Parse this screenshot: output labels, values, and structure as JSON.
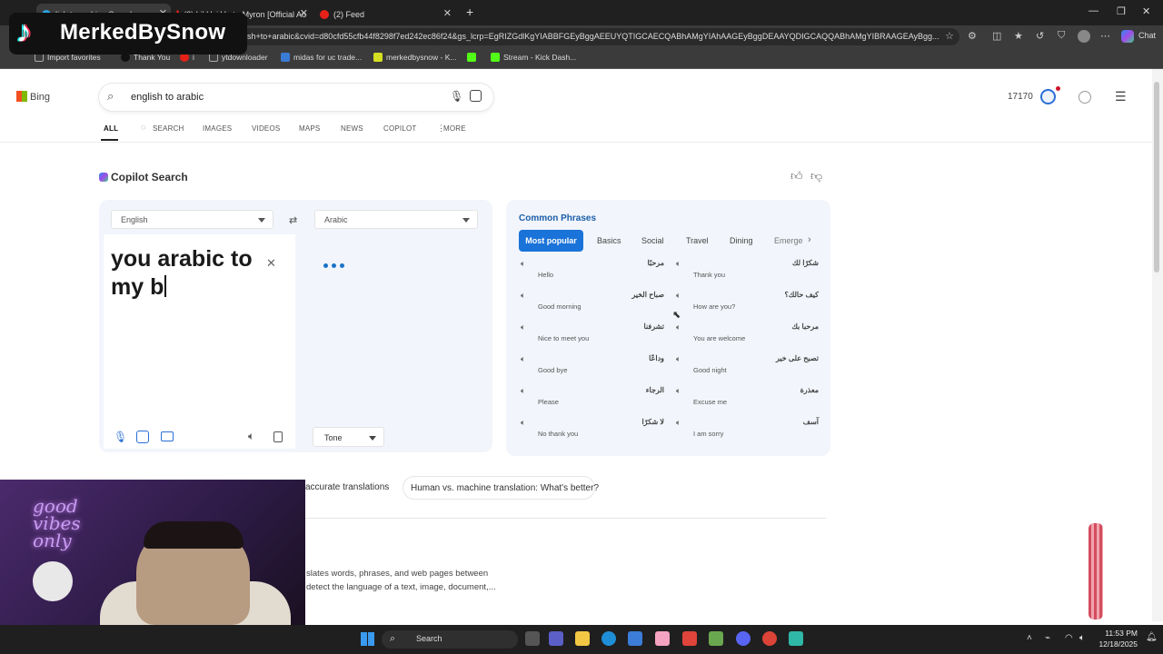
{
  "browser": {
    "tabs": [
      {
        "title": "lish to arabic - Search",
        "active": true
      },
      {
        "title": "(2) Lil Uzi Vert - Myron [Official Au",
        "active": false
      },
      {
        "title": "(2) Feed",
        "active": false
      }
    ],
    "url": "ish+to+arabic&cvid=d80cfd55cfb44f8298f7ed242ec86f24&gs_lcrp=EgRIZGdlKgYIABBFGEyBggAEEUYQTIGCAECQABhAMgYIAhAAGEyBggDEAAYQDIGCAQQABhAMgYIBRAAGEAyBgg...",
    "favorites": [
      "Import favorites",
      "Thank You",
      "i",
      "ytdownloader",
      "midas for uc trade...",
      "merkedbysnow - K...",
      "Stream - Kick Dash..."
    ],
    "chat_label": "Chat"
  },
  "bing": {
    "logo_text": "Bing",
    "query": "english to arabic",
    "rewards_count": "17170",
    "nav_tabs": [
      "ALL",
      "SEARCH",
      "IMAGES",
      "VIDEOS",
      "MAPS",
      "NEWS",
      "COPILOT",
      "MORE"
    ],
    "copilot_header": "Copilot Search"
  },
  "translator": {
    "source_lang": "English",
    "target_lang": "Arabic",
    "source_text": "you arabic to my b",
    "tone_label": "Tone"
  },
  "phrases": {
    "title": "Common Phrases",
    "tabs": [
      "Most popular",
      "Basics",
      "Social",
      "Travel",
      "Dining",
      "Emerge"
    ],
    "left": [
      {
        "ar": "مرحبًا",
        "en": "Hello"
      },
      {
        "ar": "صباح الخير",
        "en": "Good morning"
      },
      {
        "ar": "تشرفنا",
        "en": "Nice to meet you"
      },
      {
        "ar": "وداعًا",
        "en": "Good bye"
      },
      {
        "ar": "الرجاء",
        "en": "Please"
      },
      {
        "ar": "لا شكرًا",
        "en": "No thank you"
      }
    ],
    "right": [
      {
        "ar": "شكرًا لك",
        "en": "Thank you"
      },
      {
        "ar": "كيف حالك؟",
        "en": "How are you?"
      },
      {
        "ar": "مرحبا بك",
        "en": "You are welcome"
      },
      {
        "ar": "تصبح على خير",
        "en": "Good night"
      },
      {
        "ar": "معذرة",
        "en": "Excuse me"
      },
      {
        "ar": "آسف",
        "en": "I am sorry"
      }
    ]
  },
  "related": {
    "chip1": "accurate translations",
    "chip2": "Human vs. machine translation: What's better?",
    "snippet1": "slates words, phrases, and web pages between",
    "snippet2": "detect the language of a text, image, document,..."
  },
  "overlay": {
    "tiktok_name": "MerkedBySnow",
    "neon_text": "good vibes only"
  },
  "taskbar": {
    "search_label": "Search",
    "time": "11:53 PM",
    "date": "12/18/2025"
  }
}
